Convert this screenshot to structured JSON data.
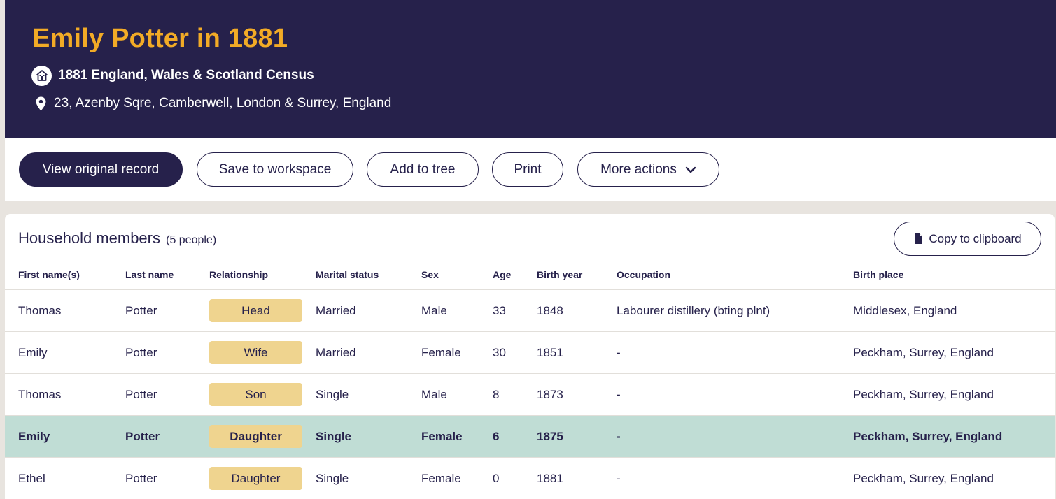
{
  "header": {
    "title": "Emily Potter in 1881",
    "census": "1881 England, Wales & Scotland Census",
    "address": "23, Azenby Sqre, Camberwell, London & Surrey, England",
    "census_icon": "house-badge-icon",
    "address_icon": "map-pin-icon"
  },
  "toolbar": {
    "view_original": "View original record",
    "save_workspace": "Save to workspace",
    "add_tree": "Add to tree",
    "print": "Print",
    "more_actions": "More actions"
  },
  "household": {
    "title": "Household members",
    "count": "(5 people)",
    "copy_label": "Copy to clipboard",
    "columns": [
      "First name(s)",
      "Last name",
      "Relationship",
      "Marital status",
      "Sex",
      "Age",
      "Birth year",
      "Occupation",
      "Birth place"
    ],
    "rows": [
      {
        "first": "Thomas",
        "last": "Potter",
        "relationship": "Head",
        "marital": "Married",
        "sex": "Male",
        "age": "33",
        "birth_year": "1848",
        "occupation": "Labourer distillery (bting plnt)",
        "birth_place": "Middlesex, England",
        "highlighted": false
      },
      {
        "first": "Emily",
        "last": "Potter",
        "relationship": "Wife",
        "marital": "Married",
        "sex": "Female",
        "age": "30",
        "birth_year": "1851",
        "occupation": "-",
        "birth_place": "Peckham, Surrey, England",
        "highlighted": false
      },
      {
        "first": "Thomas",
        "last": "Potter",
        "relationship": "Son",
        "marital": "Single",
        "sex": "Male",
        "age": "8",
        "birth_year": "1873",
        "occupation": "-",
        "birth_place": "Peckham, Surrey, England",
        "highlighted": false
      },
      {
        "first": "Emily",
        "last": "Potter",
        "relationship": "Daughter",
        "marital": "Single",
        "sex": "Female",
        "age": "6",
        "birth_year": "1875",
        "occupation": "-",
        "birth_place": "Peckham, Surrey, England",
        "highlighted": true
      },
      {
        "first": "Ethel",
        "last": "Potter",
        "relationship": "Daughter",
        "marital": "Single",
        "sex": "Female",
        "age": "0",
        "birth_year": "1881",
        "occupation": "-",
        "birth_place": "Peckham, Surrey, England",
        "highlighted": false
      }
    ]
  },
  "colors": {
    "header_bg": "#26214b",
    "title": "#f2ab26",
    "badge": "#efd48f",
    "highlight_row": "#c0ddd5",
    "page_bg": "#e8e4df"
  }
}
